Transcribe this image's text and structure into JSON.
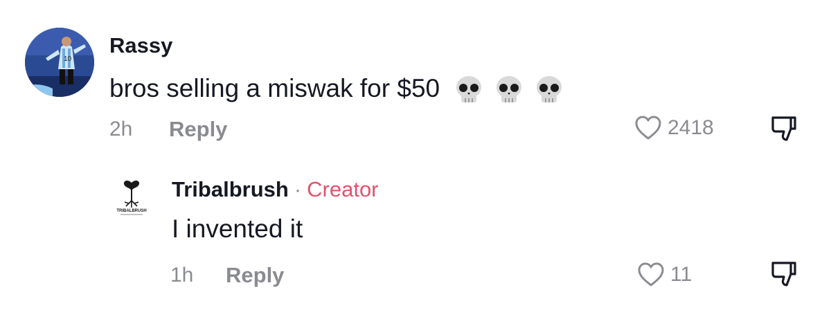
{
  "comments": [
    {
      "username": "Rassy",
      "text": "bros selling a miswak for $50",
      "emojis": [
        "skull-emoji",
        "skull-emoji",
        "skull-emoji"
      ],
      "time": "2h",
      "reply_label": "Reply",
      "likes": "2418",
      "avatar_jersey_number": "10"
    }
  ],
  "reply": {
    "username": "Tribalbrush",
    "separator": "·",
    "creator_label": "Creator",
    "text": "I invented it",
    "time": "1h",
    "reply_label": "Reply",
    "likes": "11",
    "logo_text": "TRIBALBRUSH"
  },
  "colors": {
    "text_primary": "#161823",
    "text_secondary": "#8a8b91",
    "creator_accent": "#e0536b"
  },
  "icons": {
    "like": "heart-outline-icon",
    "dislike": "thumbs-down-icon"
  }
}
